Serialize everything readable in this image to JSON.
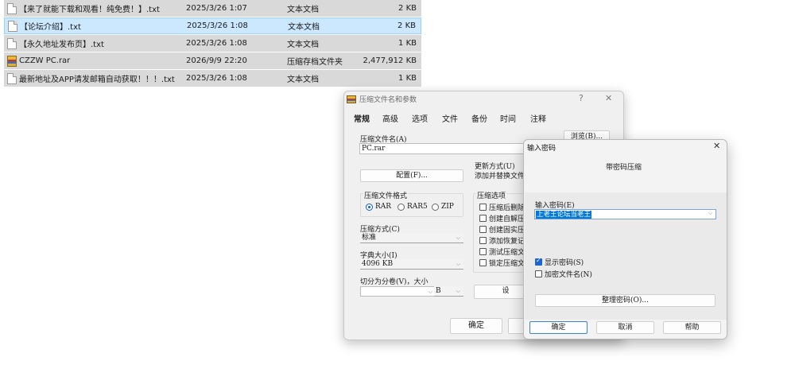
{
  "files": [
    {
      "name": "【来了就能下载和观看！纯免费！】.txt",
      "date": "2025/3/26 1:07",
      "type": "文本文档",
      "size": "2 KB",
      "icon": "txt-file-icon",
      "selected": false
    },
    {
      "name": "【论坛介绍】.txt",
      "date": "2025/3/26 1:08",
      "type": "文本文档",
      "size": "2 KB",
      "icon": "txt-file-icon",
      "selected": true
    },
    {
      "name": "【永久地址发布页】.txt",
      "date": "2025/3/26 1:08",
      "type": "文本文档",
      "size": "1 KB",
      "icon": "txt-file-icon",
      "selected": false
    },
    {
      "name": "CZZW PC.rar",
      "date": "2026/9/9 22:20",
      "type": "压缩存档文件夹",
      "size": "2,477,912 KB",
      "icon": "rar-archive-icon",
      "selected": false
    },
    {
      "name": "最新地址及APP请发邮箱自动获取！！！.txt",
      "date": "2025/3/26 1:08",
      "type": "文本文档",
      "size": "1 KB",
      "icon": "txt-file-icon",
      "selected": false
    }
  ],
  "archive_dialog": {
    "title": "压缩文件名和参数",
    "help_glyph": "?",
    "close_glyph": "✕",
    "tabs": [
      "常规",
      "高级",
      "选项",
      "文件",
      "备份",
      "时间",
      "注释"
    ],
    "archive_name_label": "压缩文件名(A)",
    "archive_name_value": "PC.rar",
    "browse_label": "浏览(B)...",
    "update_mode_label": "更新方式(U)",
    "update_mode_value": "添加并替换文件",
    "profiles_label": "配置(F)...",
    "format_group_label": "压缩文件格式",
    "formats": [
      {
        "label": "RAR",
        "checked": true
      },
      {
        "label": "RAR5",
        "checked": false
      },
      {
        "label": "ZIP",
        "checked": false
      }
    ],
    "method_label": "压缩方式(C)",
    "method_value": "标准",
    "dict_label": "字典大小(I)",
    "dict_value": "4096 KB",
    "split_label": "切分为分卷(V)，大小",
    "split_unit": "B",
    "options_group_label": "压缩选项",
    "options": [
      "压缩后删除",
      "创建自解压",
      "创建固实压",
      "添加恢复记",
      "测试压缩文",
      "锁定压缩文"
    ],
    "set_password_label": "设",
    "ok_label": "确定"
  },
  "password_dialog": {
    "title": "输入密码",
    "close_glyph": "✕",
    "header": "带密码压缩",
    "enter_password_label": "输入密码(E)",
    "password_value": "上老王论坛当老王",
    "show_password_label": "显示密码(S)",
    "show_password_checked": true,
    "encrypt_names_label": "加密文件名(N)",
    "encrypt_names_checked": false,
    "organize_label": "整理密码(O)...",
    "ok_label": "确定",
    "cancel_label": "取消",
    "help_label": "帮助"
  }
}
